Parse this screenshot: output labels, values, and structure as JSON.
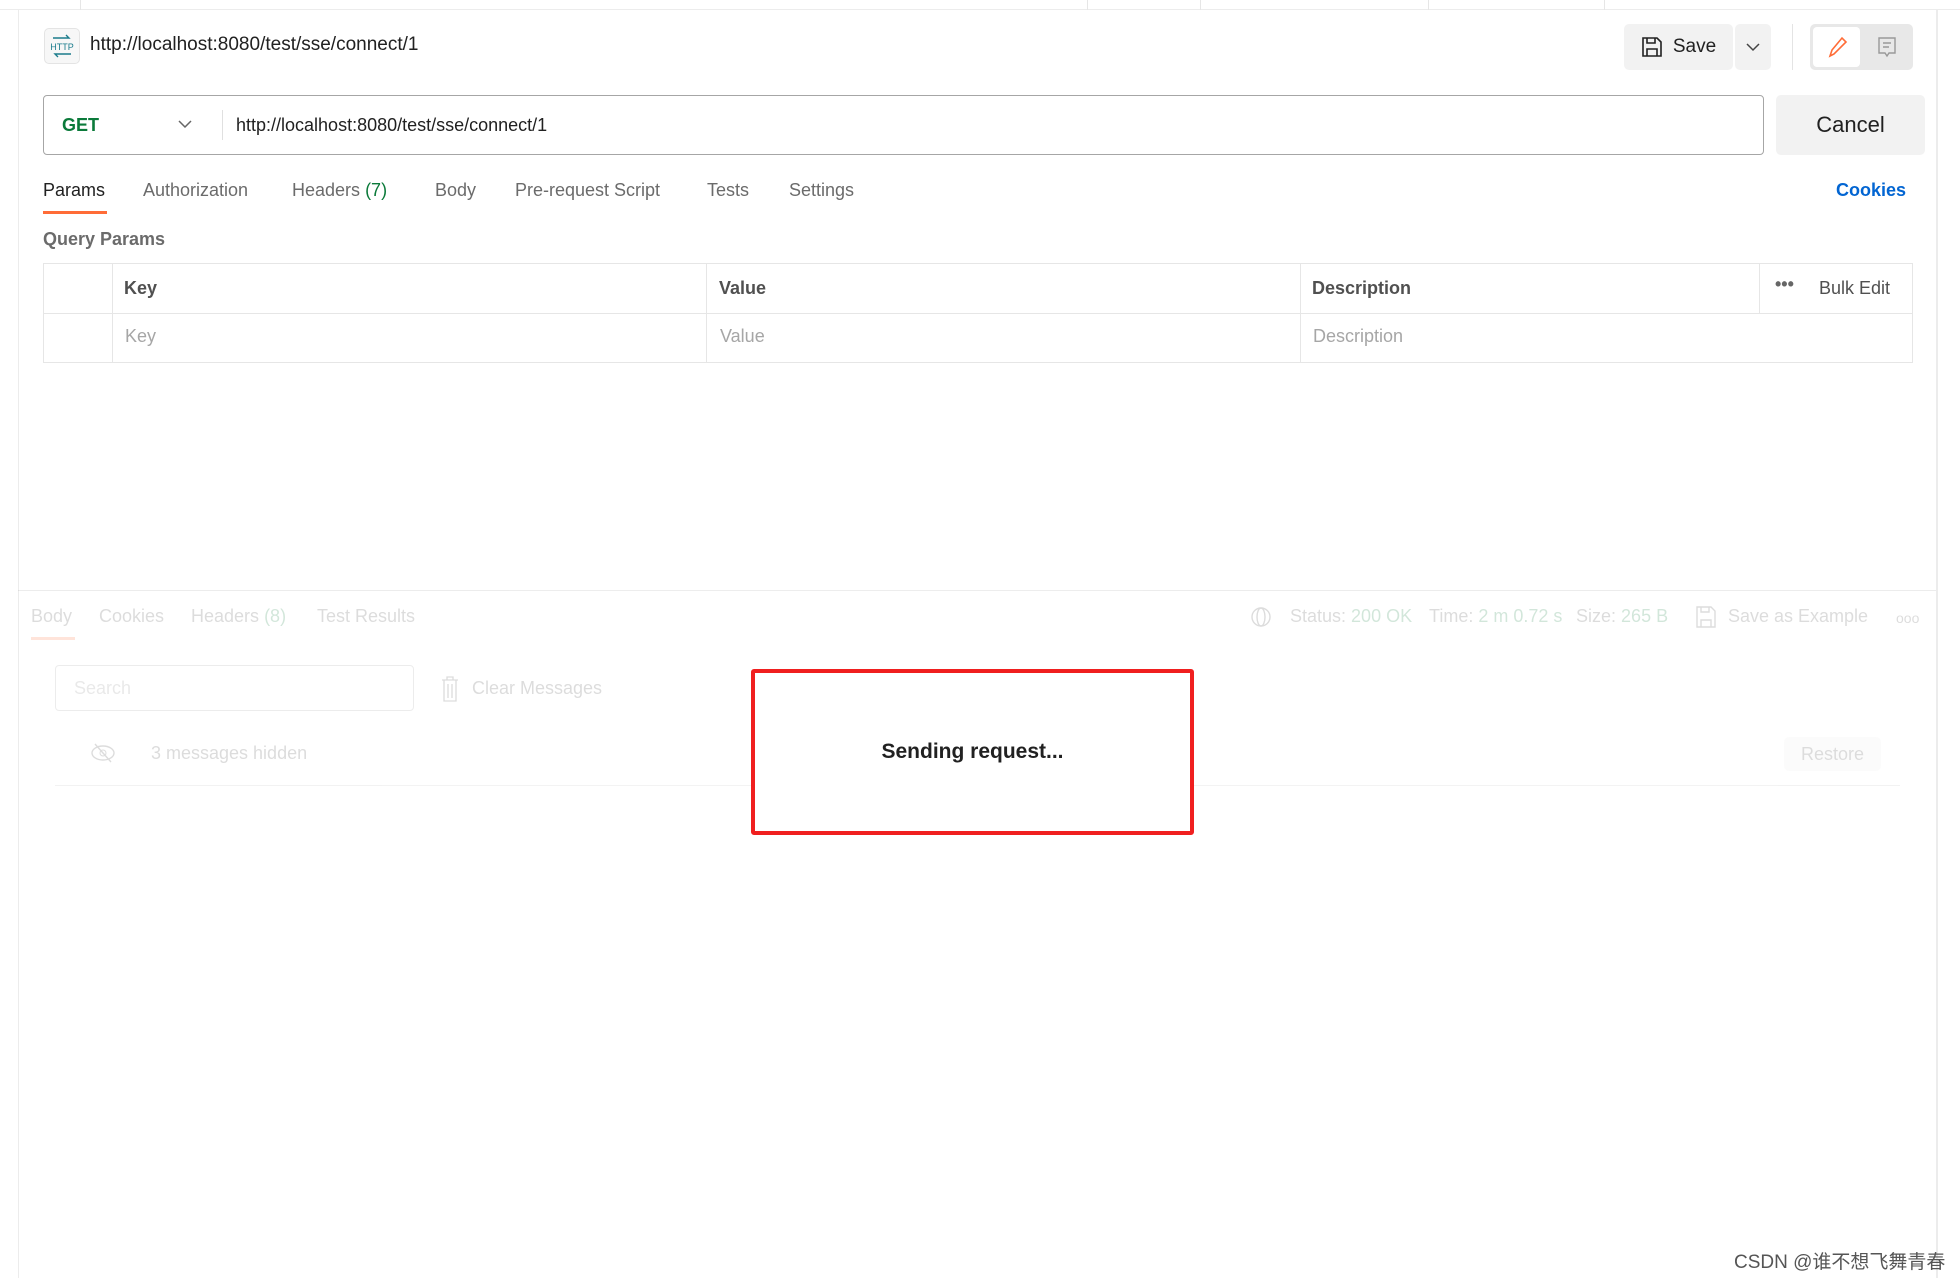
{
  "header": {
    "title": "http://localhost:8080/test/sse/connect/1",
    "save_label": "Save"
  },
  "request": {
    "method": "GET",
    "url": "http://localhost:8080/test/sse/connect/1",
    "cancel_label": "Cancel"
  },
  "tabs": [
    {
      "label": "Params"
    },
    {
      "label": "Authorization"
    },
    {
      "label": "Headers",
      "count": "(7)"
    },
    {
      "label": "Body"
    },
    {
      "label": "Pre-request Script"
    },
    {
      "label": "Tests"
    },
    {
      "label": "Settings"
    }
  ],
  "cookies_link": "Cookies",
  "query_params": {
    "title": "Query Params",
    "columns": [
      "Key",
      "Value",
      "Description"
    ],
    "bulk_edit": "Bulk Edit",
    "placeholders": [
      "Key",
      "Value",
      "Description"
    ]
  },
  "response": {
    "tabs": [
      {
        "label": "Body"
      },
      {
        "label": "Cookies"
      },
      {
        "label": "Headers",
        "count": "(8)"
      },
      {
        "label": "Test Results"
      }
    ],
    "status_label": "Status:",
    "status": "200 OK",
    "time_label": "Time:",
    "time": "2 m 0.72 s",
    "size_label": "Size:",
    "size": "265 B",
    "save_example": "Save as Example",
    "search_placeholder": "Search",
    "clear_messages": "Clear Messages",
    "hidden_messages": "3 messages hidden",
    "restore": "Restore"
  },
  "overlay": {
    "text": "Sending request..."
  },
  "watermark": "CSDN @谁不想飞舞青春",
  "colors": {
    "accent": "#ff6c37",
    "method": "#0b7a3a",
    "link": "#0265d2",
    "highlight_box": "#f01f1f"
  }
}
